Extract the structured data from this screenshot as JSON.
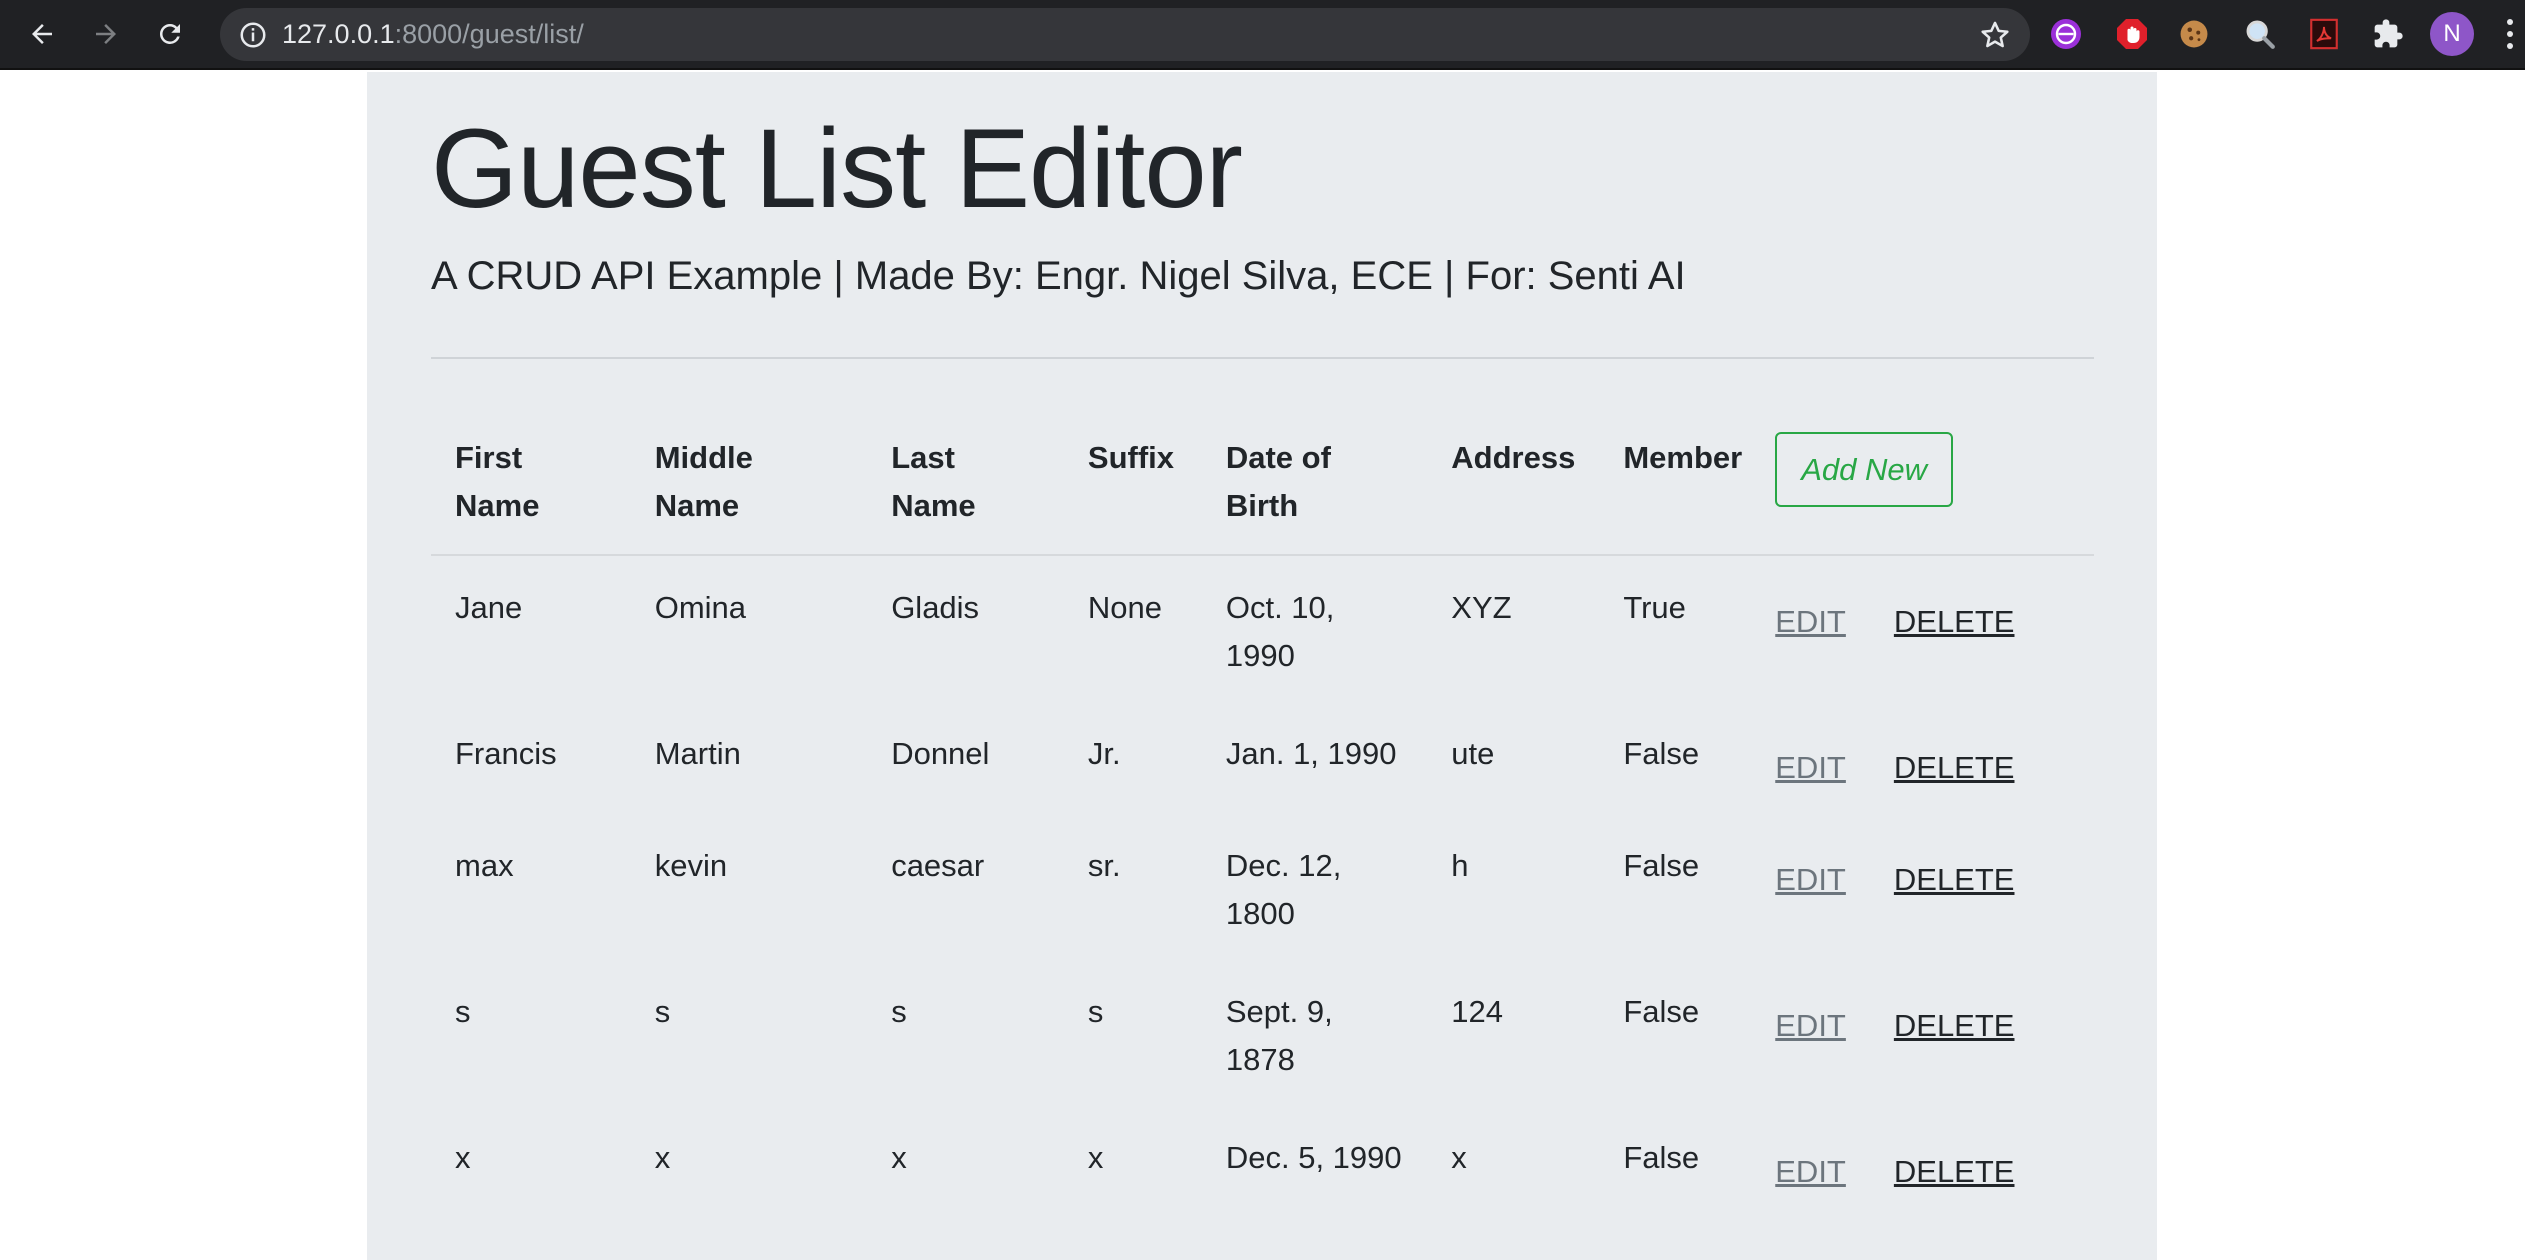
{
  "browser": {
    "url_host": "127.0.0.1",
    "url_path": ":8000/guest/list/",
    "profile_initial": "N"
  },
  "page": {
    "title": "Guest List Editor",
    "subtitle": "A CRUD API Example | Made By: Engr. Nigel Silva, ECE | For: Senti AI"
  },
  "table": {
    "headers": {
      "first_name": "First Name",
      "middle_name": "Middle Name",
      "last_name": "Last Name",
      "suffix": "Suffix",
      "dob": "Date of Birth",
      "address": "Address",
      "member": "Member"
    },
    "add_new_label": "Add New",
    "edit_label": "EDIT",
    "delete_label": "DELETE",
    "rows": [
      {
        "first": "Jane",
        "middle": "Omina",
        "last": "Gladis",
        "suffix": "None",
        "dob": "Oct. 10, 1990",
        "address": "XYZ",
        "member": "True"
      },
      {
        "first": "Francis",
        "middle": "Martin",
        "last": "Donnel",
        "suffix": "Jr.",
        "dob": "Jan. 1, 1990",
        "address": "ute",
        "member": "False"
      },
      {
        "first": "max",
        "middle": "kevin",
        "last": "caesar",
        "suffix": "sr.",
        "dob": "Dec. 12, 1800",
        "address": "h",
        "member": "False"
      },
      {
        "first": "s",
        "middle": "s",
        "last": "s",
        "suffix": "s",
        "dob": "Sept. 9, 1878",
        "address": "124",
        "member": "False"
      },
      {
        "first": "x",
        "middle": "x",
        "last": "x",
        "suffix": "x",
        "dob": "Dec. 5, 1990",
        "address": "x",
        "member": "False"
      }
    ]
  },
  "colors": {
    "chrome_bg": "#202124",
    "page_bg": "#e9ecef",
    "add_new": "#28a745",
    "edit_link": "#6c757d",
    "text": "#212529"
  },
  "icons": [
    "back-icon",
    "forward-icon",
    "reload-icon",
    "info-icon",
    "star-icon",
    "extension-purple-icon",
    "stop-hand-icon",
    "cookie-icon",
    "magnifier-icon",
    "pdf-icon",
    "puzzle-icon",
    "menu-dots-icon"
  ]
}
